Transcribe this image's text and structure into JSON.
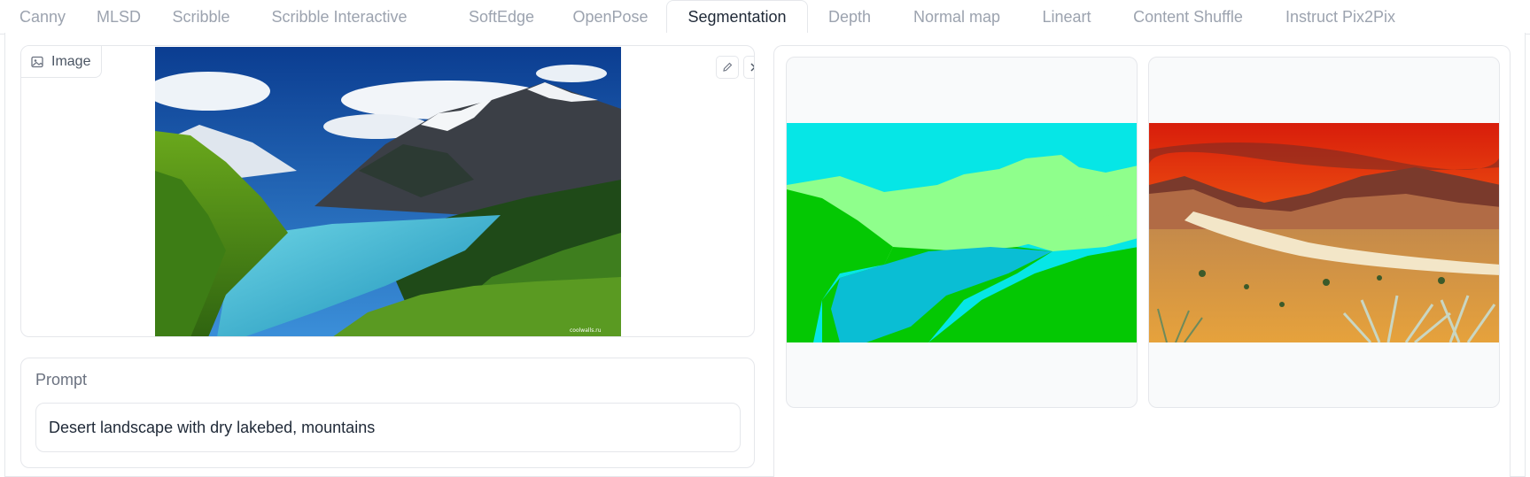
{
  "tabs": [
    {
      "label": "Canny",
      "active": false
    },
    {
      "label": "MLSD",
      "active": false
    },
    {
      "label": "Scribble",
      "active": false
    },
    {
      "label": "Scribble Interactive",
      "active": false
    },
    {
      "label": "SoftEdge",
      "active": false
    },
    {
      "label": "OpenPose",
      "active": false
    },
    {
      "label": "Segmentation",
      "active": true
    },
    {
      "label": "Depth",
      "active": false
    },
    {
      "label": "Normal map",
      "active": false
    },
    {
      "label": "Lineart",
      "active": false
    },
    {
      "label": "Content Shuffle",
      "active": false
    },
    {
      "label": "Instruct Pix2Pix",
      "active": false
    }
  ],
  "input_image": {
    "label": "Image",
    "label_icon": "image-icon",
    "edit_icon": "pencil-icon",
    "clear_icon": "close-icon",
    "content": "mountain lake landscape",
    "watermark": "coolwalls.ru"
  },
  "prompt": {
    "label": "Prompt",
    "value": "Desert landscape with dry lakebed, mountains"
  },
  "gallery": {
    "items": [
      {
        "content": "segmentation map"
      },
      {
        "content": "generated desert landscape"
      }
    ]
  },
  "colors": {
    "seg_sky": "#06e6e6",
    "seg_mountain": "#8fff8c",
    "seg_tree": "#04c803",
    "seg_water": "#0abed4",
    "accent_border": "#e5e7eb"
  }
}
